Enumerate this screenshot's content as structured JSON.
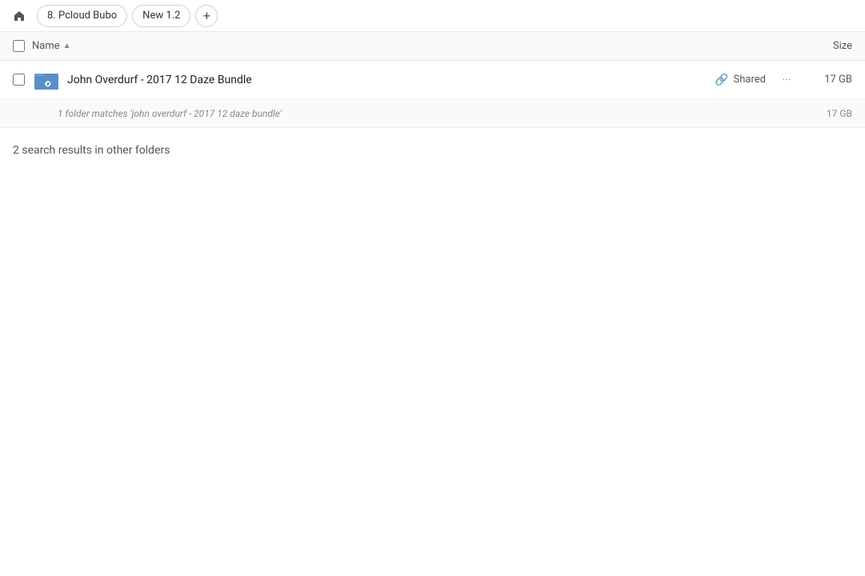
{
  "topbar": {
    "home_icon": "🏠",
    "breadcrumbs": [
      {
        "label": "8. Pcloud Bubo"
      },
      {
        "label": "New 1.2"
      }
    ],
    "add_tab_icon": "+"
  },
  "columns": {
    "name_label": "Name",
    "sort_icon": "▲",
    "size_label": "Size"
  },
  "main_result": {
    "icon_color": "#4a7eb5",
    "name": "John Overdurf - 2017 12 Daze Bundle",
    "shared_label": "Shared",
    "more_icon": "···",
    "size": "17 GB"
  },
  "sub_result": {
    "text": "1 folder matches 'john overdurf - 2017 12 daze bundle'",
    "size": "17 GB"
  },
  "other_folders_section": {
    "title": "2 search results in other folders"
  }
}
